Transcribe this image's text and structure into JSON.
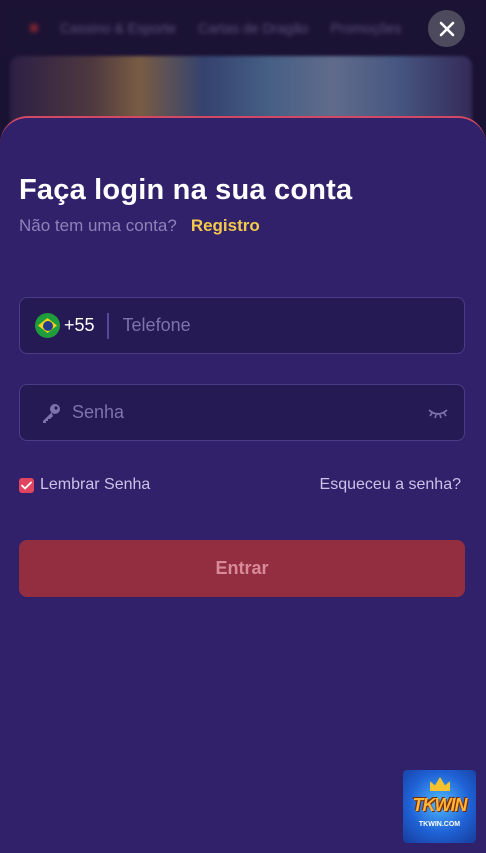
{
  "background": {
    "nav_items": [
      "Cassino & Esporte",
      "Cartas de Dragão",
      "Promoções"
    ]
  },
  "login": {
    "title": "Faça login na sua conta",
    "no_account_text": "Não tem uma conta?",
    "register_link": "Registro",
    "phone": {
      "country_code": "+55",
      "placeholder": "Telefone",
      "value": ""
    },
    "password": {
      "placeholder": "Senha",
      "value": ""
    },
    "remember_label": "Lembrar Senha",
    "remember_checked": true,
    "forgot_link": "Esqueceu a senha?",
    "submit_label": "Entrar"
  },
  "logo": {
    "brand": "TKWIN",
    "domain": "TKWIN.COM"
  },
  "colors": {
    "sheet": "#31206a",
    "accent": "#e0445f",
    "link": "#f2c94c",
    "submit": "#932e40"
  },
  "icons": {
    "close": "close-icon",
    "flag": "brazil-flag-icon",
    "key": "key-icon",
    "eye": "eye-closed-icon",
    "check": "checkmark-icon"
  }
}
